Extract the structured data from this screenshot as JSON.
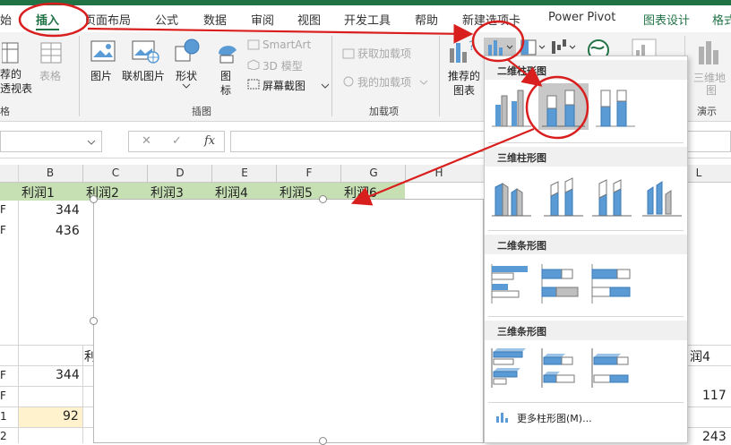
{
  "tabs": {
    "home": "始",
    "insert": "插入",
    "layout": "页面布局",
    "formula": "公式",
    "data": "数据",
    "review": "审阅",
    "view": "视图",
    "developer": "开发工具",
    "help": "帮助",
    "newtab": "新建选项卡",
    "powerpivot": "Power Pivot",
    "chartdesign": "图表设计",
    "format": "格式"
  },
  "ribbon": {
    "recommended_pivot_1": "荐的",
    "recommended_pivot_2": "透视表",
    "table": "表格",
    "group_tables": "格",
    "pictures": "图片",
    "online_pictures": "联机图片",
    "shapes": "形状",
    "icons_1": "图",
    "icons_2": "标",
    "smartart": "SmartArt",
    "model3d": "3D 模型",
    "screenshot": "屏幕截图",
    "group_illustrations": "插图",
    "get_addins": "获取加载项",
    "my_addins": "我的加载项",
    "group_addins": "加载项",
    "recommended_charts_1": "推荐的",
    "recommended_charts_2": "图表",
    "map3d_1": "三维地",
    "map3d_2": "图",
    "group_tours": "演示"
  },
  "formula_bar": {
    "cancel": "✕",
    "enter": "✓",
    "fx": "fx"
  },
  "columns": [
    "B",
    "C",
    "D",
    "E",
    "F",
    "G",
    "H",
    "L"
  ],
  "header_row": [
    "利润1",
    "利润2",
    "利润3",
    "利润4",
    "利润5",
    "利润6"
  ],
  "rows": {
    "r1_label": "F",
    "r1_value": "344",
    "r2_label": "F",
    "r2_value": "436",
    "lower_r1_label": "F",
    "lower_r1_value": "344",
    "lower_r2_label": "F",
    "lower_r3_label": "1",
    "lower_r3_value": "92",
    "lower_r4_label": "2",
    "lower_c_header": "利",
    "right_header": "润4",
    "right_value_1": "117",
    "right_value_2": "243"
  },
  "dropdown": {
    "sec_2d_col": "二维柱形图",
    "sec_3d_col": "三维柱形图",
    "sec_2d_bar": "二维条形图",
    "sec_3d_bar": "三维条形图",
    "more_charts": "更多柱形图(M)..."
  },
  "colors": {
    "accent_green": "#217346",
    "header_fill": "#c6e0b4",
    "annotation_red": "#d91e1e",
    "chart_blue": "#5b9bd5",
    "chart_gray": "#b4b4b4",
    "highlight_cell": "#fff2cc"
  }
}
